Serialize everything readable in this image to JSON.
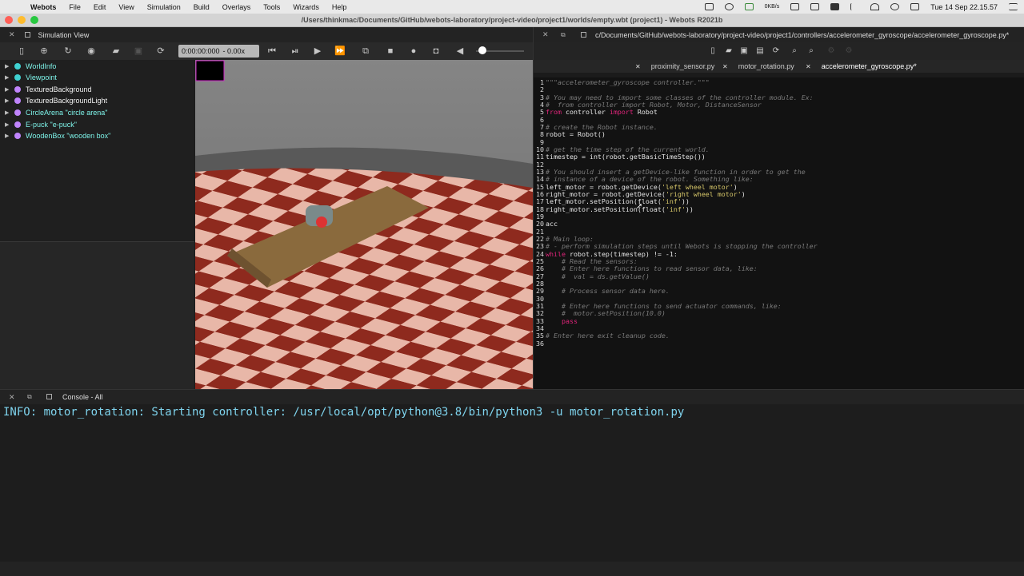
{
  "menubar": {
    "apple": "",
    "items": [
      "Webots",
      "File",
      "Edit",
      "View",
      "Simulation",
      "Build",
      "Overlays",
      "Tools",
      "Wizards",
      "Help"
    ],
    "net_speed": "0KB/s",
    "clock": "Tue 14 Sep 22.15.57"
  },
  "window": {
    "title": "/Users/thinkmac/Documents/GitHub/webots-laboratory/project-video/project1/worlds/empty.wbt (project1) - Webots R2021b"
  },
  "simulation_view": {
    "title": "Simulation View",
    "time": "0:00:00:000",
    "speed": "- 0.00x",
    "scene_tree": [
      {
        "label": "WorldInfo",
        "color": "#3fd1d1"
      },
      {
        "label": "Viewpoint",
        "color": "#3fd1d1"
      },
      {
        "label": "TexturedBackground",
        "color": "#c084fc"
      },
      {
        "label": "TexturedBackgroundLight",
        "color": "#c084fc"
      },
      {
        "label": "CircleArena \"circle arena\"",
        "color": "#c084fc"
      },
      {
        "label": "E-puck \"e-puck\"",
        "color": "#c084fc"
      },
      {
        "label": "WoodenBox \"wooden box\"",
        "color": "#c084fc"
      }
    ]
  },
  "editor": {
    "path": "c/Documents/GitHub/webots-laboratory/project-video/project1/controllers/accelerometer_gyroscope/accelerometer_gyroscope.py*",
    "tabs": [
      {
        "label": "proximity_sensor.py",
        "active": false
      },
      {
        "label": "motor_rotation.py",
        "active": false
      },
      {
        "label": "accelerometer_gyroscope.py*",
        "active": true
      }
    ],
    "lines": [
      {
        "n": "1",
        "t": "\"\"\"accelerometer_gyroscope controller.\"\"\"",
        "c": "cm"
      },
      {
        "n": "2",
        "t": "",
        "c": "ct"
      },
      {
        "n": "3",
        "t": "# You may need to import some classes of the controller module. Ex:",
        "c": "cm"
      },
      {
        "n": "4",
        "t": "#  from controller import Robot, Motor, DistanceSensor",
        "c": "cm"
      },
      {
        "n": "5",
        "t": "from controller import Robot",
        "c": "imp"
      },
      {
        "n": "6",
        "t": "",
        "c": "ct"
      },
      {
        "n": "7",
        "t": "# create the Robot instance.",
        "c": "cm"
      },
      {
        "n": "8",
        "t": "robot = Robot()",
        "c": "ct"
      },
      {
        "n": "9",
        "t": "",
        "c": "ct"
      },
      {
        "n": "10",
        "t": "# get the time step of the current world.",
        "c": "cm"
      },
      {
        "n": "11",
        "t": "timestep = int(robot.getBasicTimeStep())",
        "c": "ct"
      },
      {
        "n": "12",
        "t": "",
        "c": "ct"
      },
      {
        "n": "13",
        "t": "# You should insert a getDevice-like function in order to get the",
        "c": "cm"
      },
      {
        "n": "14",
        "t": "# instance of a device of the robot. Something like:",
        "c": "cm"
      },
      {
        "n": "15",
        "t": "left_motor = robot.getDevice('left wheel motor')",
        "c": "str"
      },
      {
        "n": "16",
        "t": "right_motor = robot.getDevice('right wheel motor')",
        "c": "str"
      },
      {
        "n": "17",
        "t": "left_motor.setPosition(float('inf'))",
        "c": "str"
      },
      {
        "n": "18",
        "t": "right_motor.setPosition(float('inf'))",
        "c": "str"
      },
      {
        "n": "19",
        "t": "",
        "c": "ct"
      },
      {
        "n": "20",
        "t": "acc",
        "c": "ct"
      },
      {
        "n": "21",
        "t": "",
        "c": "ct"
      },
      {
        "n": "22",
        "t": "# Main loop:",
        "c": "cm"
      },
      {
        "n": "23",
        "t": "# - perform simulation steps until Webots is stopping the controller",
        "c": "cm"
      },
      {
        "n": "24",
        "t": "while robot.step(timestep) != -1:",
        "c": "while"
      },
      {
        "n": "25",
        "t": "    # Read the sensors:",
        "c": "cm"
      },
      {
        "n": "26",
        "t": "    # Enter here functions to read sensor data, like:",
        "c": "cm"
      },
      {
        "n": "27",
        "t": "    #  val = ds.getValue()",
        "c": "cm"
      },
      {
        "n": "28",
        "t": "",
        "c": "ct"
      },
      {
        "n": "29",
        "t": "    # Process sensor data here.",
        "c": "cm"
      },
      {
        "n": "30",
        "t": "",
        "c": "ct"
      },
      {
        "n": "31",
        "t": "    # Enter here functions to send actuator commands, like:",
        "c": "cm"
      },
      {
        "n": "32",
        "t": "    #  motor.setPosition(10.0)",
        "c": "cm"
      },
      {
        "n": "33",
        "t": "    pass",
        "c": "kwonly"
      },
      {
        "n": "34",
        "t": "",
        "c": "ct"
      },
      {
        "n": "35",
        "t": "# Enter here exit cleanup code.",
        "c": "cm"
      },
      {
        "n": "36",
        "t": "",
        "c": "ct"
      }
    ]
  },
  "console": {
    "title": "Console - All",
    "line": "INFO: motor_rotation: Starting controller: /usr/local/opt/python@3.8/bin/python3 -u motor_rotation.py"
  }
}
